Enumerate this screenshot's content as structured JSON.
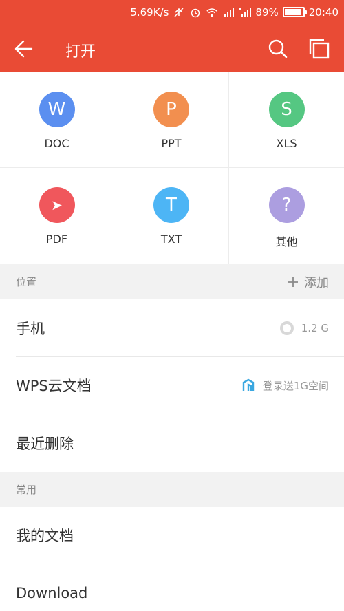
{
  "status_bar": {
    "speed": "5.69K/s",
    "battery": "89%",
    "battery_level": 0.89,
    "time": "20:40",
    "icons": [
      "sync-off-icon",
      "alarm-icon",
      "wifi-icon",
      "signal-icon",
      "4g-signal-icon"
    ]
  },
  "toolbar": {
    "title": "打开",
    "back_icon": "back-arrow-icon",
    "search_icon": "search-icon",
    "multiwindow_icon": "multi-window-icon",
    "bg_color": "#e94b35"
  },
  "file_types": [
    {
      "label": "DOC",
      "glyph": "W",
      "color": "#5b8ff0",
      "icon": "doc-icon"
    },
    {
      "label": "PPT",
      "glyph": "P",
      "color": "#f28f4f",
      "icon": "ppt-icon"
    },
    {
      "label": "XLS",
      "glyph": "S",
      "color": "#55c782",
      "icon": "xls-icon"
    },
    {
      "label": "PDF",
      "glyph": "➤",
      "color": "#f0575c",
      "icon": "pdf-icon"
    },
    {
      "label": "TXT",
      "glyph": "T",
      "color": "#4db5f5",
      "icon": "txt-icon"
    },
    {
      "label": "其他",
      "glyph": "?",
      "color": "#ac9ee0",
      "icon": "other-icon"
    }
  ],
  "location_section": {
    "title": "位置",
    "add_label": "添加"
  },
  "locations": {
    "phone": {
      "label": "手机",
      "storage": "1.2 G"
    },
    "cloud": {
      "label": "WPS云文档",
      "hint": "登录送1G空间"
    },
    "recent_deleted": {
      "label": "最近删除"
    }
  },
  "common_section": {
    "title": "常用"
  },
  "common": {
    "my_docs": {
      "label": "我的文档"
    },
    "download": {
      "label": "Download"
    }
  }
}
